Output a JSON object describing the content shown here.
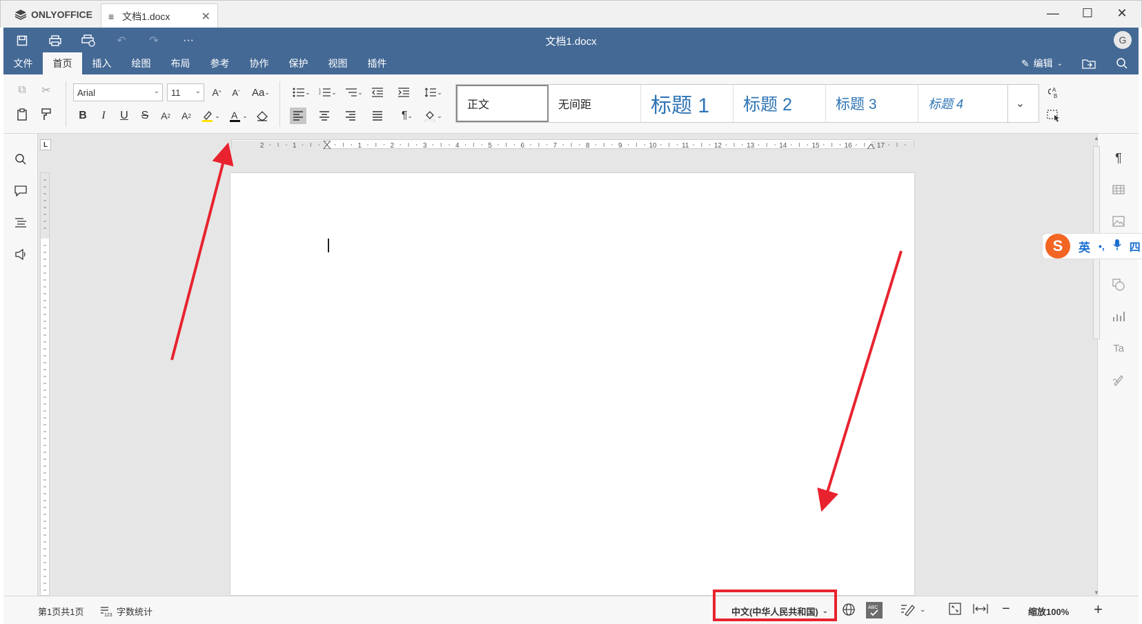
{
  "window": {
    "app_name": "ONLYOFFICE",
    "tab_title": "文档1.docx",
    "document_title": "文档1.docx",
    "user_initial": "G"
  },
  "menu": {
    "tabs": [
      "文件",
      "首页",
      "插入",
      "绘图",
      "布局",
      "参考",
      "协作",
      "保护",
      "视图",
      "插件"
    ],
    "active": "首页",
    "edit_mode_label": "编辑"
  },
  "toolbar": {
    "font_name": "Arial",
    "font_size": "11",
    "styles": [
      "正文",
      "无间距",
      "标题 1",
      "标题 2",
      "标题 3",
      "标题 4"
    ],
    "style_colors": {
      "heading": "#2e74b5",
      "normal": "#222222"
    }
  },
  "ruler": {
    "numbers": [
      "2",
      "1",
      "1",
      "2",
      "3",
      "4",
      "5",
      "6",
      "7",
      "8",
      "9",
      "10",
      "11",
      "12",
      "13",
      "14",
      "15",
      "16",
      "17"
    ]
  },
  "statusbar": {
    "page_info": "第1页共1页",
    "word_count_label": "字数统计",
    "language": "中文(中华人民共和国)",
    "zoom_label": "缩放100%"
  },
  "ime": {
    "logo_letter": "S",
    "mode_char": "英",
    "punct": "•,",
    "extra": "四"
  },
  "colors": {
    "header_bg": "#446995",
    "toolbar_bg": "#f7f7f7",
    "workspace_bg": "#e6e6e6",
    "annotation_red": "#e8232f",
    "highlight_yellow": "#ffe000"
  }
}
